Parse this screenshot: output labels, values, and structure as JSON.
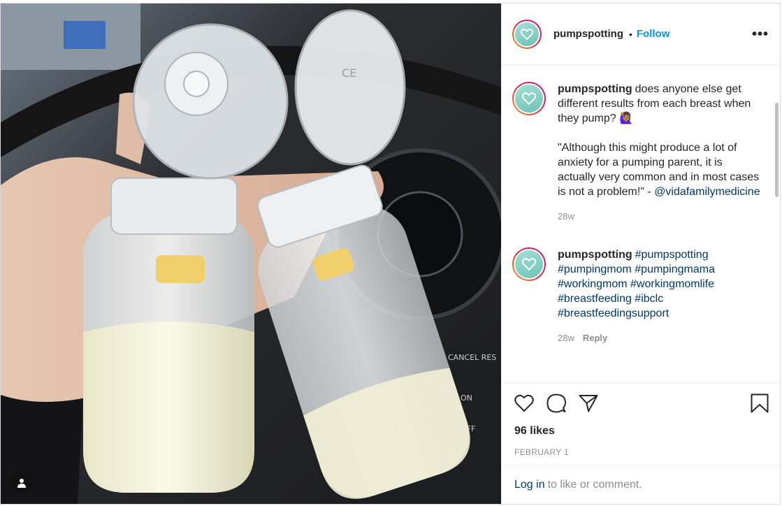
{
  "header": {
    "username": "pumpspotting",
    "separator": "•",
    "follow_label": "Follow",
    "more_label": "•••"
  },
  "comments": [
    {
      "username": "pumpspotting",
      "text": "does anyone else get different results from each breast when they pump? 🙋🏽‍♀️\n\n\"Although this might produce a lot of anxiety for a pumping parent, it is actually very common and in most cases is not a problem!\" - ",
      "mention": "@vidafamilymedicine",
      "time": "28w",
      "reply": ""
    },
    {
      "username": "pumpspotting",
      "hashtags": "#pumpspotting #pumpingmom #pumpingmama #workingmom #workingmomlife #breastfeeding #ibclc #breastfeedingsupport",
      "time": "28w",
      "reply": "Reply"
    }
  ],
  "actions": {
    "likes": "96 likes",
    "date": "FEBRUARY 1"
  },
  "login": {
    "link_label": "Log in",
    "rest": "to like or comment."
  },
  "colors": {
    "follow_blue": "#0095f6",
    "link_blue": "#00376b",
    "muted": "#8e8e8e",
    "avatar_teal": "#7dcdc0"
  },
  "icons": [
    "heart-icon",
    "comment-icon",
    "share-icon",
    "bookmark-icon",
    "user-tag-icon",
    "more-icon"
  ]
}
